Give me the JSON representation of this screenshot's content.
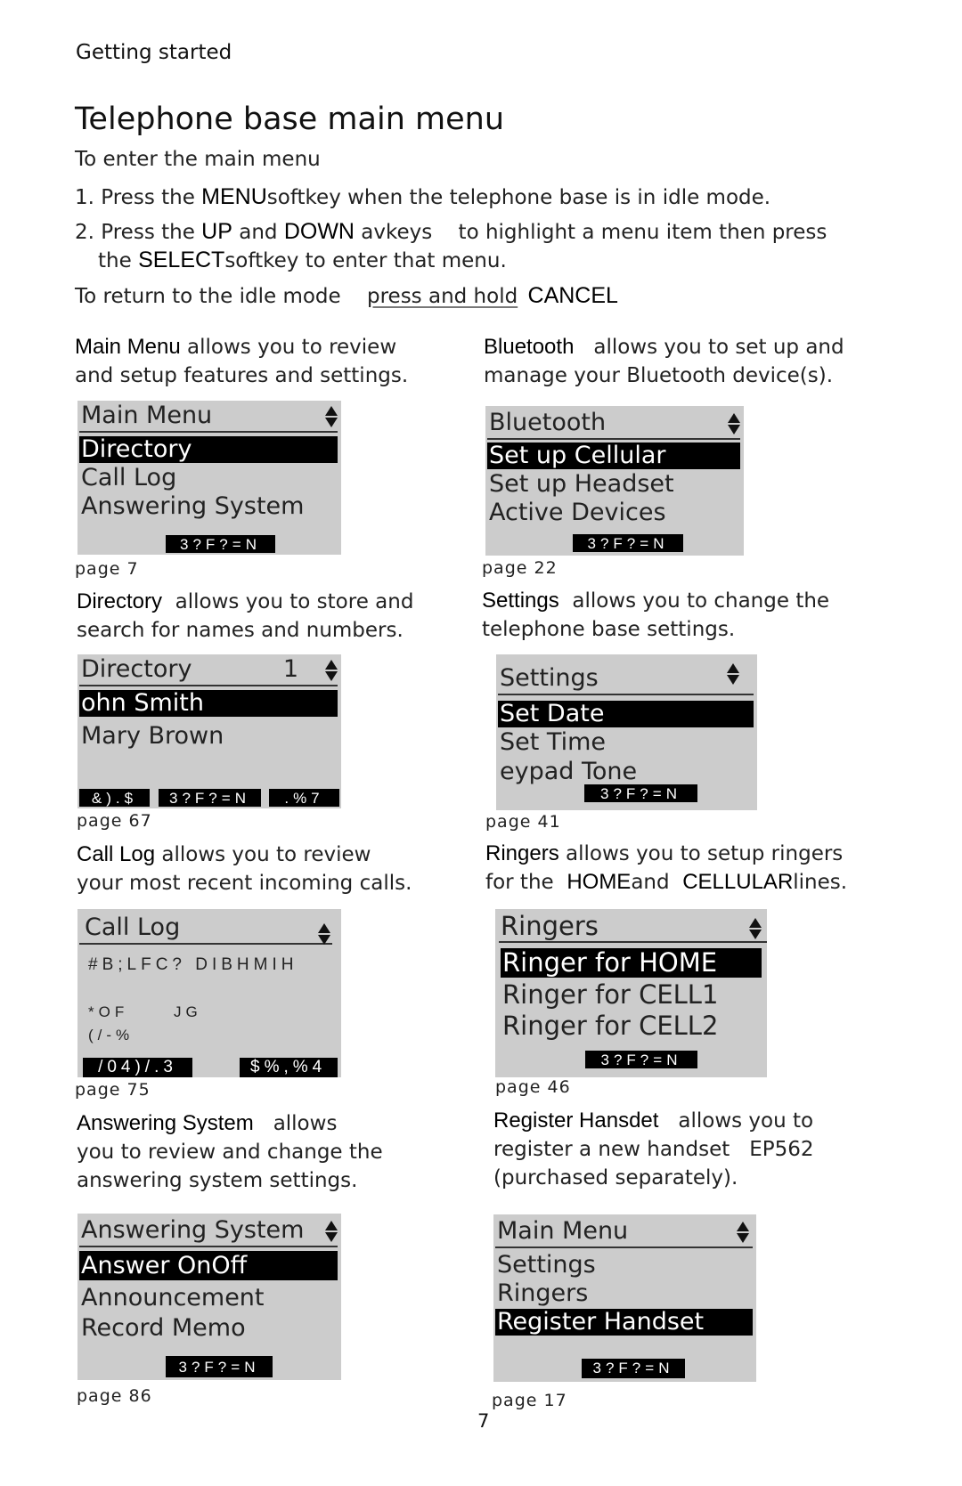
{
  "section_label": "Getting started",
  "title": "Telephone base main menu",
  "intro": {
    "heading": "To enter the main menu",
    "step1": {
      "num": "1.",
      "pre": "Press the",
      "key": "MENU",
      "post": "softkey when the telephone base is in idle mode."
    },
    "step2": {
      "num": "2.",
      "pre": "Press the",
      "key1": "UP",
      "mid": "and",
      "key2": "DOWN",
      "post1": "avkeys",
      "post2": "to highlight a menu item then press",
      "line2_pre": "the",
      "key3": "SELECT",
      "line2_post": "softkey to enter that menu."
    },
    "return": {
      "pre": "To return to the idle mode",
      "link": "press and hold",
      "key": "CANCEL"
    }
  },
  "sections": {
    "main_menu": {
      "desc_kw": "Main Menu",
      "desc_1": "allows you to review",
      "desc_2": "and setup features and settings.",
      "screen": {
        "title": "Main Menu",
        "rows": [
          "Directory",
          "Call Log",
          "Answering System"
        ],
        "selected": 0,
        "softkeys": [
          "3?F?=N"
        ]
      },
      "page_ref": "page 7"
    },
    "bluetooth": {
      "desc_kw": "Bluetooth",
      "desc_1": "allows you to set up and",
      "desc_2": "manage your Bluetooth device(s).",
      "screen": {
        "title": "Bluetooth",
        "rows": [
          "Set up Cellular",
          "Set up Headset",
          "Active Devices"
        ],
        "selected": 0,
        "softkeys": [
          "3?F?=N"
        ]
      },
      "page_ref": "page 22"
    },
    "directory": {
      "desc_kw": "Directory",
      "desc_1": "allows you to store and",
      "desc_2": "search for names and numbers.",
      "screen": {
        "title": "Directory",
        "count": "1",
        "rows": [
          "ohn Smith",
          "Mary Brown"
        ],
        "selected": 0,
        "softkeys": [
          "&).$",
          "3?F?=N",
          ".%7"
        ]
      },
      "page_ref": "page 67"
    },
    "settings": {
      "desc_kw": "Settings",
      "desc_1": "allows you to change the",
      "desc_2": "telephone base settings.",
      "screen": {
        "title": "Settings",
        "rows": [
          "Set Date",
          "Set Time",
          "eypad Tone"
        ],
        "selected": 0,
        "softkeys": [
          "3?F?=N"
        ]
      },
      "page_ref": "page 41"
    },
    "call_log": {
      "desc_kw": "Call Log",
      "desc_1": "allows you to review",
      "desc_2": "your most recent incoming calls.",
      "screen": {
        "title": "Call Log",
        "line1": "#B;LFC? DIBHMIH",
        "line2a": "*OF",
        "line2b": "JG",
        "line3": "(/-%",
        "softkeys": [
          "/04)/.3",
          "$%,%4"
        ]
      },
      "page_ref": "page 75"
    },
    "ringers": {
      "desc_kw": "Ringers",
      "desc_1": "allows you to setup ringers",
      "desc_2_pre": "for the",
      "desc_2_kw1": "HOME",
      "desc_2_mid": "and",
      "desc_2_kw2": "CELLULAR",
      "desc_2_post": "lines.",
      "screen": {
        "title": "Ringers",
        "rows": [
          "Ringer for HOME",
          "Ringer for CELL1",
          "Ringer for CELL2"
        ],
        "selected": 0,
        "softkeys": [
          "3?F?=N"
        ]
      },
      "page_ref": "page 46"
    },
    "answering_system": {
      "desc_kw": "Answering System",
      "desc_1": "allows",
      "desc_2": "you to review and change the",
      "desc_3": "answering system settings.",
      "screen": {
        "title": "Answering System",
        "rows": [
          "Answer OnOff",
          "Announcement",
          "Record Memo"
        ],
        "selected": 0,
        "softkeys": [
          "3?F?=N"
        ]
      },
      "page_ref": "page 86"
    },
    "register_handset": {
      "desc_kw": "Register Hansdet",
      "desc_1": "allows you to",
      "desc_2_pre": "register a new handset",
      "desc_2_model": "EP562",
      "desc_3": "(purchased separately).",
      "screen": {
        "title": "Main Menu",
        "rows": [
          "Settings",
          "Ringers",
          "Register Handset"
        ],
        "selected": 2,
        "softkeys": [
          "3?F?=N"
        ]
      },
      "page_ref": "page 17"
    }
  },
  "page_number": "7"
}
